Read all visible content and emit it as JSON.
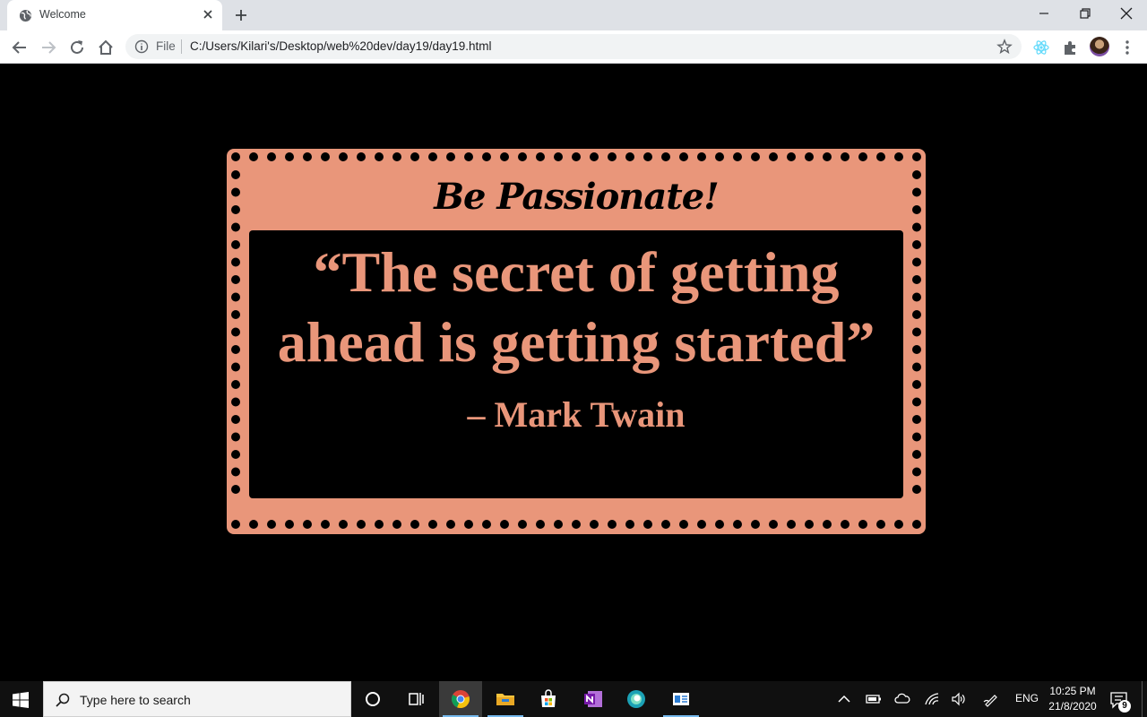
{
  "browser": {
    "tab_title": "Welcome",
    "omnibox_scheme": "File",
    "url": "C:/Users/Kilari's/Desktop/web%20dev/day19/day19.html"
  },
  "card": {
    "title": "Be Passionate!",
    "quote_line1": "“The secret of getting",
    "quote_line2": "ahead is getting started”",
    "author": "– Mark Twain"
  },
  "taskbar": {
    "search_placeholder": "Type here to search",
    "language": "ENG",
    "time": "10:25 PM",
    "date": "21/8/2020",
    "notification_count": "9"
  },
  "colors": {
    "accent": "#e9967a",
    "page_background": "#000000"
  },
  "icons": [
    "globe-icon",
    "close-icon",
    "plus-icon",
    "minimize-icon",
    "restore-icon",
    "back-icon",
    "forward-icon",
    "reload-icon",
    "home-icon",
    "info-icon",
    "star-icon",
    "react-icon",
    "puzzle-icon",
    "menu-icon",
    "windows-icon",
    "search-icon",
    "cortana-icon",
    "task-view-icon",
    "chrome-icon",
    "file-explorer-icon",
    "store-icon",
    "onenote-icon",
    "edge-icon",
    "app-icon",
    "chevron-up-icon",
    "battery-icon",
    "cloud-icon",
    "wifi-icon",
    "volume-icon",
    "pen-icon",
    "notification-icon"
  ]
}
